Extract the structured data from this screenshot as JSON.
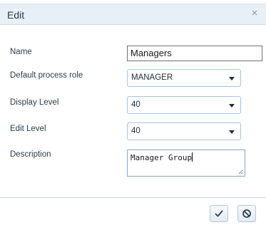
{
  "dialog": {
    "title": "Edit",
    "close_glyph": "×"
  },
  "form": {
    "name": {
      "label": "Name",
      "value": "Managers"
    },
    "default_process_role": {
      "label": "Default process role",
      "value": "MANAGER"
    },
    "display_level": {
      "label": "Display Level",
      "value": "40"
    },
    "edit_level": {
      "label": "Edit Level",
      "value": "40"
    },
    "description": {
      "label": "Description",
      "value": "Manager Group"
    }
  },
  "footer": {
    "confirm_icon": "check-icon",
    "cancel_icon": "ban-icon"
  },
  "colors": {
    "titlebar_bg": "#e8f0f7",
    "select_border": "#a3c4e8"
  }
}
